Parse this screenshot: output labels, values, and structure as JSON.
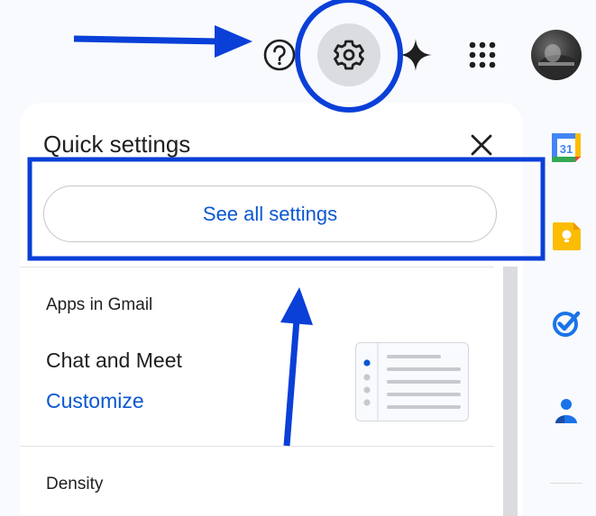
{
  "topbar": {
    "icons": [
      "help-icon",
      "settings-gear-icon",
      "gemini-spark-icon",
      "google-apps-grid-icon",
      "account-avatar"
    ]
  },
  "quick_settings": {
    "title": "Quick settings",
    "see_all_label": "See all settings",
    "apps_in_gmail_heading": "Apps in Gmail",
    "chat_and_meet_label": "Chat and Meet",
    "customize_link": "Customize",
    "density_heading": "Density"
  },
  "side_rail": {
    "calendar_day": "31",
    "icons": [
      "google-calendar-icon",
      "google-keep-icon",
      "google-tasks-icon",
      "google-contacts-icon"
    ]
  },
  "colors": {
    "accent_blue": "#0b57d0",
    "annotation_blue": "#0a3fd8",
    "panel_bg": "#ffffff",
    "page_bg": "#f8fafd"
  }
}
